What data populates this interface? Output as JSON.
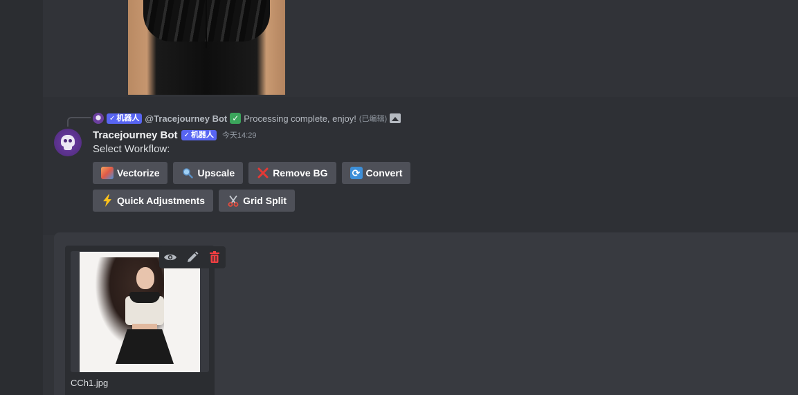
{
  "reply": {
    "bot_tag": "机器人",
    "mention": "@Tracejourney Bot",
    "text": "Processing complete, enjoy!",
    "edited": "(已编辑)"
  },
  "message": {
    "username": "Tracejourney Bot",
    "bot_tag": "机器人",
    "timestamp": "今天14:29",
    "content": "Select Workflow:"
  },
  "buttons": {
    "row1": [
      {
        "label": "Vectorize",
        "icon": "framed-picture-icon"
      },
      {
        "label": "Upscale",
        "icon": "magnifying-glass-icon"
      },
      {
        "label": "Remove BG",
        "icon": "cross-mark-icon"
      },
      {
        "label": "Convert",
        "icon": "arrows-cycle-icon"
      }
    ],
    "row2": [
      {
        "label": "Quick Adjustments",
        "icon": "lightning-icon"
      },
      {
        "label": "Grid Split",
        "icon": "scissors-icon"
      }
    ]
  },
  "upload": {
    "file_name": "CCh1.jpg",
    "tools": [
      "eye-icon",
      "pencil-icon",
      "trash-icon"
    ]
  },
  "colors": {
    "background": "#313338",
    "button": "#4e5058",
    "bot_tag": "#5865f2",
    "delete": "#f23f42"
  }
}
